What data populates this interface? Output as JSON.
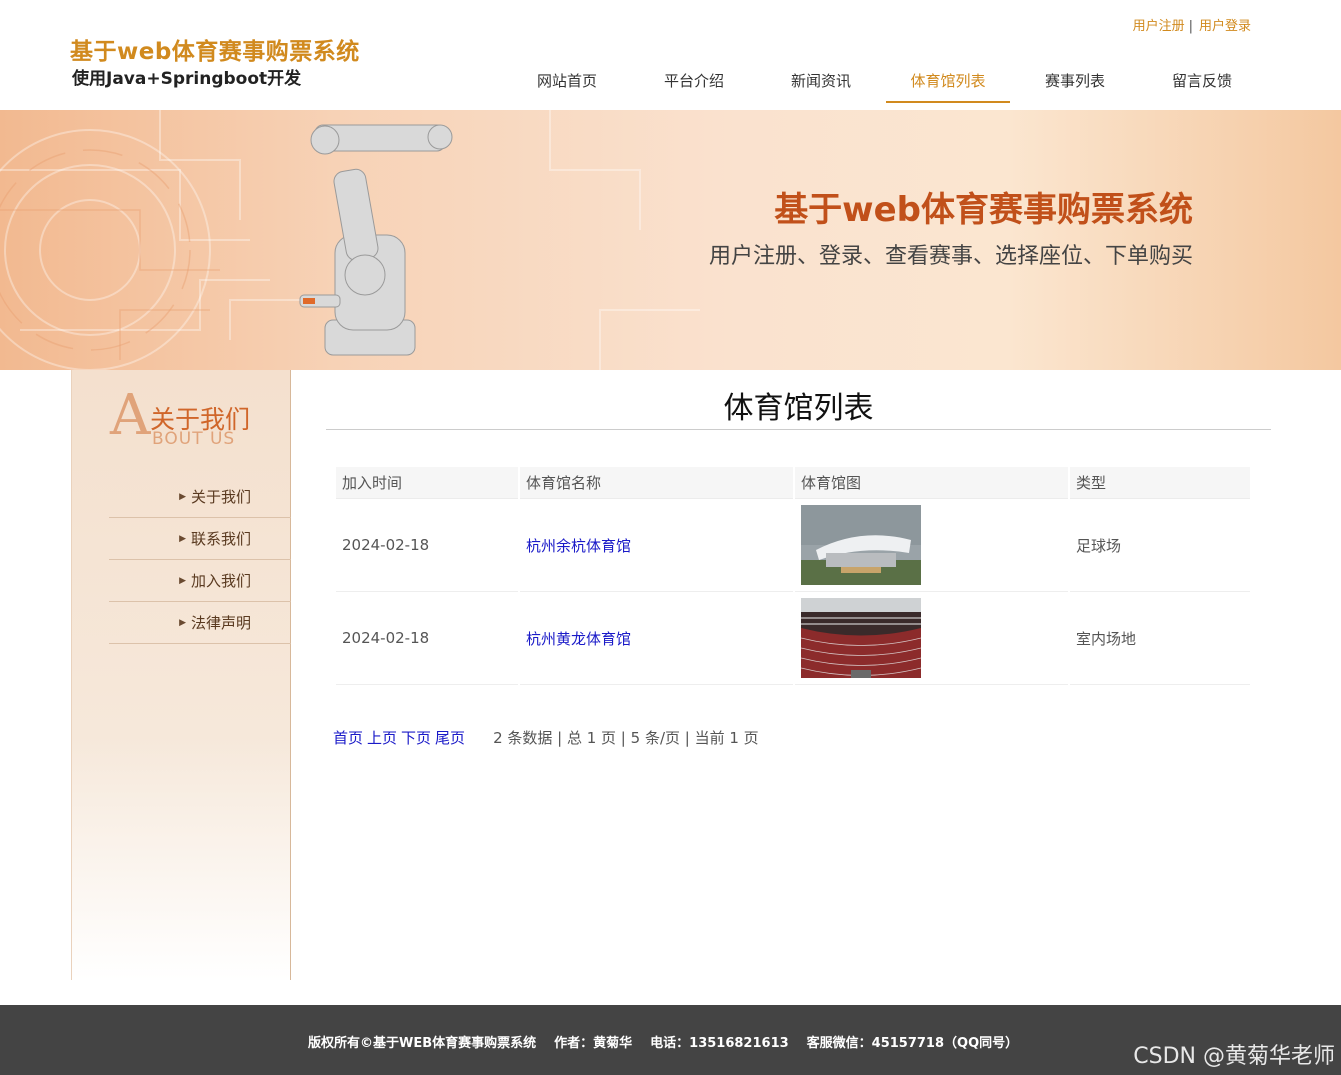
{
  "header": {
    "logo_title": "基于web体育赛事购票系统",
    "logo_subtitle": "使用Java+Springboot开发",
    "register": "用户注册",
    "login": "用户登录",
    "separator": "|"
  },
  "nav": {
    "items": [
      "网站首页",
      "平台介绍",
      "新闻资讯",
      "体育馆列表",
      "赛事列表",
      "留言反馈"
    ],
    "active_index": 3
  },
  "banner": {
    "title": "基于web体育赛事购票系统",
    "subtitle": "用户注册、登录、查看赛事、选择座位、下单购买"
  },
  "sidebar": {
    "big_letter": "A",
    "title_cn": "关于我们",
    "title_en": "BOUT US",
    "items": [
      "关于我们",
      "联系我们",
      "加入我们",
      "法律声明"
    ]
  },
  "main": {
    "page_title": "体育馆列表",
    "table": {
      "headers": [
        "加入时间",
        "体育馆名称",
        "体育馆图",
        "类型"
      ],
      "rows": [
        {
          "date": "2024-02-18",
          "name": "杭州余杭体育馆",
          "image": "stadium-exterior-image",
          "type": "足球场"
        },
        {
          "date": "2024-02-18",
          "name": "杭州黄龙体育馆",
          "image": "arena-interior-image",
          "type": "室内场地"
        }
      ]
    },
    "pager": {
      "first": "首页",
      "prev": "上页",
      "next": "下页",
      "last": "尾页",
      "info": "2 条数据 | 总 1 页 | 5 条/页 | 当前 1 页"
    }
  },
  "footer": {
    "copyright": "版权所有©基于WEB体育赛事购票系统",
    "author": "作者：黄菊华",
    "phone": "电话：13516821613",
    "wechat": "客服微信：45157718（QQ同号）",
    "watermark": "CSDN @黄菊华老师"
  },
  "colors": {
    "accent": "#d18a1e",
    "banner_title": "#c1501a",
    "link": "#1a1ac8",
    "footer_bg": "#444444"
  }
}
